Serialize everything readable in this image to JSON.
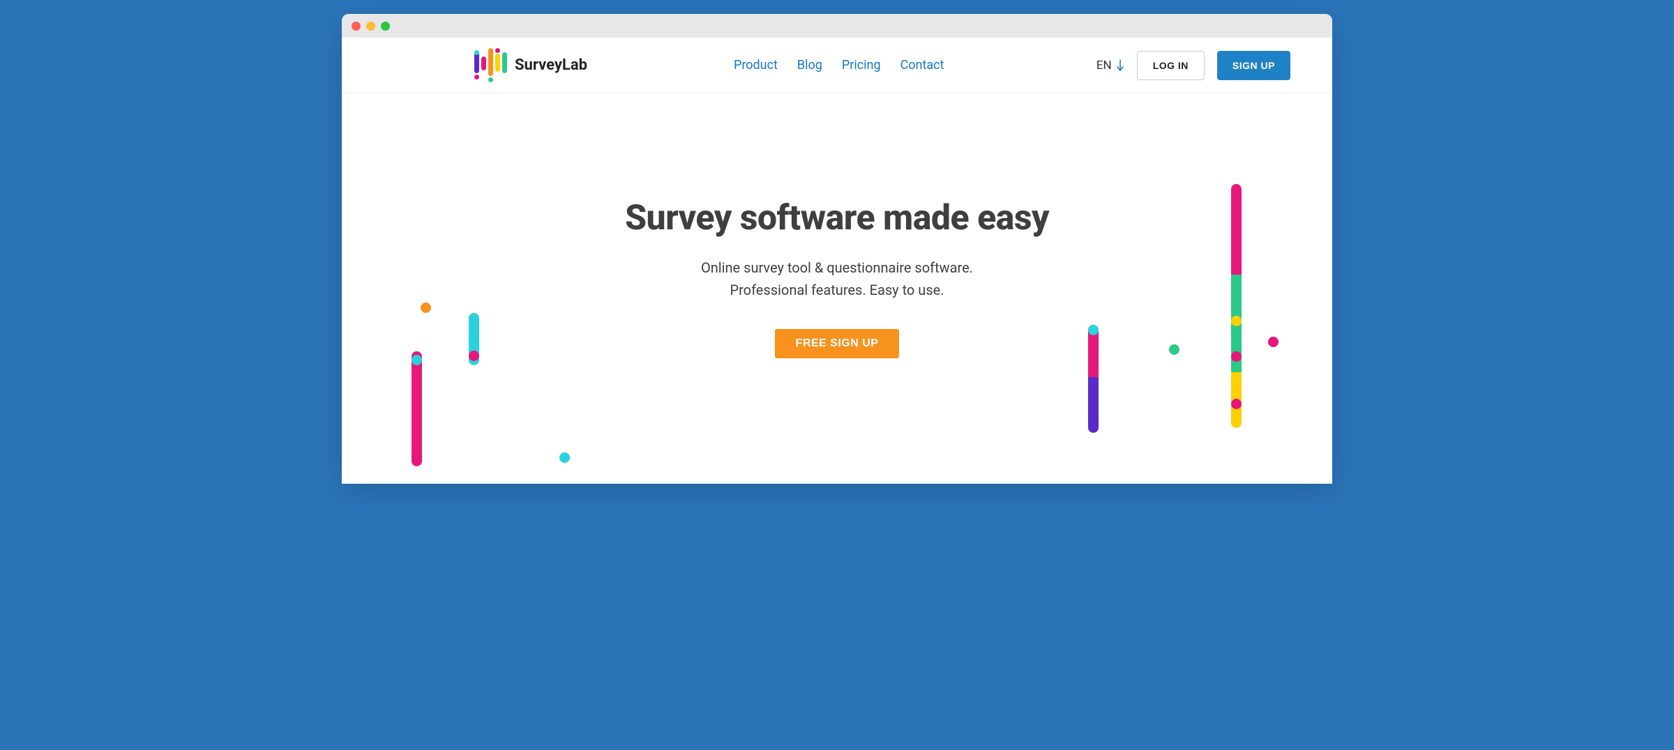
{
  "brand": {
    "name": "SurveyLab"
  },
  "nav": {
    "items": [
      {
        "label": "Product"
      },
      {
        "label": "Blog"
      },
      {
        "label": "Pricing"
      },
      {
        "label": "Contact"
      }
    ]
  },
  "header": {
    "language": "EN",
    "login_label": "LOG IN",
    "signup_label": "SIGN UP"
  },
  "hero": {
    "title": "Survey software made easy",
    "subtitle_line1": "Online survey tool & questionnaire software.",
    "subtitle_line2": "Professional features. Easy to use.",
    "cta_label": "FREE SIGN UP"
  },
  "colors": {
    "accent_blue": "#1f81c5",
    "cta_orange": "#f7921e",
    "pink": "#e6177a",
    "cyan": "#2bd1df",
    "green": "#2bc98a",
    "yellow": "#ffd100",
    "purple": "#5a2bca"
  }
}
